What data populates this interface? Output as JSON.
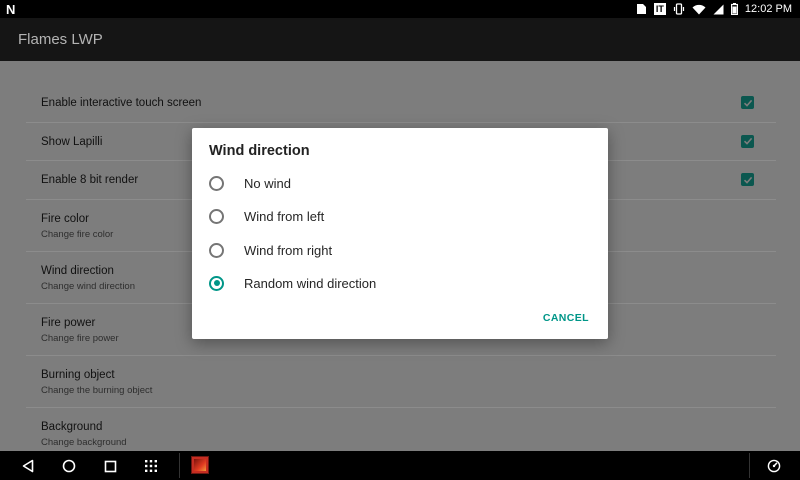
{
  "status_bar": {
    "notification_icon": "N",
    "it_badge": "IT",
    "time": "12:02 PM"
  },
  "app_bar": {
    "title": "Flames LWP"
  },
  "preferences": [
    {
      "title": "Enable interactive touch screen",
      "checked": true
    },
    {
      "title": "Show Lapilli",
      "checked": true
    },
    {
      "title": "Enable 8 bit render",
      "checked": true
    },
    {
      "title": "Fire color",
      "summary": "Change fire color"
    },
    {
      "title": "Wind direction",
      "summary": "Change wind direction"
    },
    {
      "title": "Fire power",
      "summary": "Change fire power"
    },
    {
      "title": "Burning object",
      "summary": "Change the burning object"
    },
    {
      "title": "Background",
      "summary": "Change background"
    }
  ],
  "dialog": {
    "title": "Wind direction",
    "options": [
      {
        "label": "No wind",
        "selected": false
      },
      {
        "label": "Wind from left",
        "selected": false
      },
      {
        "label": "Wind from right",
        "selected": false
      },
      {
        "label": "Random wind direction",
        "selected": true
      }
    ],
    "cancel_label": "CANCEL"
  },
  "colors": {
    "accent": "#009688",
    "checkbox_dimmed": "#0b574f",
    "app_bar": "#151515",
    "scrim_background": "#7d7d7d"
  },
  "nav_bar": {
    "icons": [
      "back-icon",
      "home-icon",
      "recents-icon",
      "app-drawer-icon",
      "flames-app-icon",
      "performance-icon"
    ]
  }
}
